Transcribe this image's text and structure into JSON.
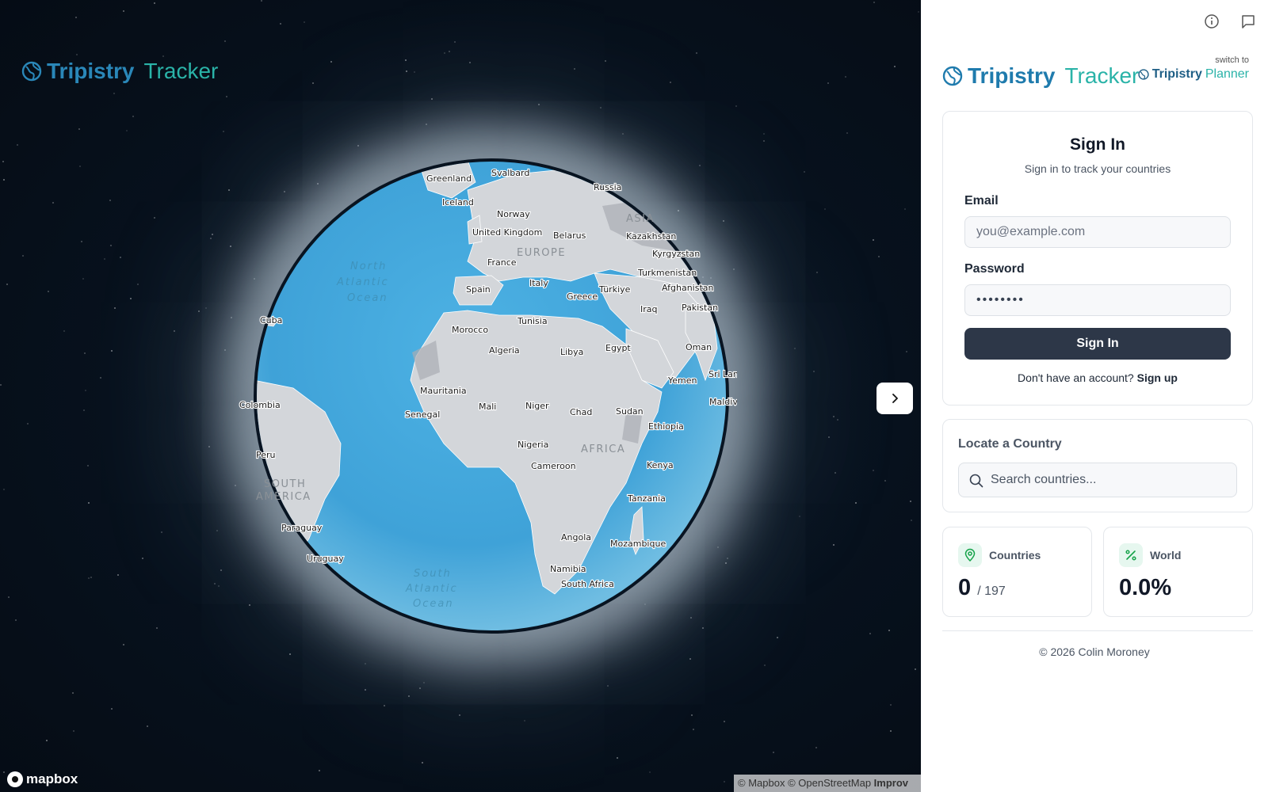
{
  "map": {
    "brand": {
      "word1": "Tripistry",
      "word2": "Tracker"
    },
    "attribution": {
      "mapbox": "© Mapbox",
      "osm": "© OpenStreetMap",
      "improve": "Improv"
    },
    "mapbox_logo_text": "mapbox",
    "globe_labels": {
      "countries": [
        "Greenland",
        "Svalbard",
        "Russia",
        "Iceland",
        "Norway",
        "United Kingdom",
        "Belarus",
        "Kazakhstan",
        "Kyrgyzstan",
        "France",
        "Turkmenistan",
        "Spain",
        "Italy",
        "Türkiye",
        "Afghanistan",
        "Greece",
        "Iraq",
        "Pakistan",
        "Cuba",
        "Tunisia",
        "Morocco",
        "Algeria",
        "Libya",
        "Egypt",
        "Oman",
        "Sri Lanka",
        "Yemen",
        "Maldives",
        "Colombia",
        "Mauritania",
        "Mali",
        "Niger",
        "Chad",
        "Sudan",
        "Senegal",
        "Ethiopia",
        "Nigeria",
        "Cameroon",
        "Kenya",
        "Peru",
        "Tanzania",
        "Paraguay",
        "Angola",
        "Mozambique",
        "Uruguay",
        "Namibia",
        "South Africa"
      ],
      "regions": [
        "ASIA",
        "EUROPE",
        "AFRICA",
        "SOUTH",
        "AMERICA"
      ],
      "oceans": [
        "North",
        "Atlantic",
        "Ocean",
        "South",
        "Atlantic",
        "Ocean"
      ]
    },
    "next_icon": "chevron-right-icon"
  },
  "sidebar": {
    "icons": [
      "info-icon",
      "feedback-icon"
    ],
    "brand": {
      "word1": "Tripistry",
      "word2": "Tracker"
    },
    "switch": {
      "label": "switch to",
      "word1": "Tripistry",
      "word2": "Planner"
    },
    "signin": {
      "title": "Sign In",
      "subtitle": "Sign in to track your countries",
      "email_label": "Email",
      "email_placeholder": "you@example.com",
      "password_label": "Password",
      "password_value": "••••••••",
      "button": "Sign In",
      "no_account": "Don't have an account?",
      "signup": "Sign up"
    },
    "locate": {
      "title": "Locate a Country",
      "placeholder": "Search countries..."
    },
    "stats": {
      "countries": {
        "title": "Countries",
        "value": "0",
        "total": "/ 197"
      },
      "world": {
        "title": "World",
        "value": "0.0%"
      }
    },
    "footer": "© 2026 Colin Moroney",
    "colors": {
      "accent_blue": "#1f7bad",
      "accent_teal": "#2ab3a8",
      "button_dark": "#2d3748",
      "ocean": "#46a8dc",
      "land": "#d2d5d9"
    }
  }
}
